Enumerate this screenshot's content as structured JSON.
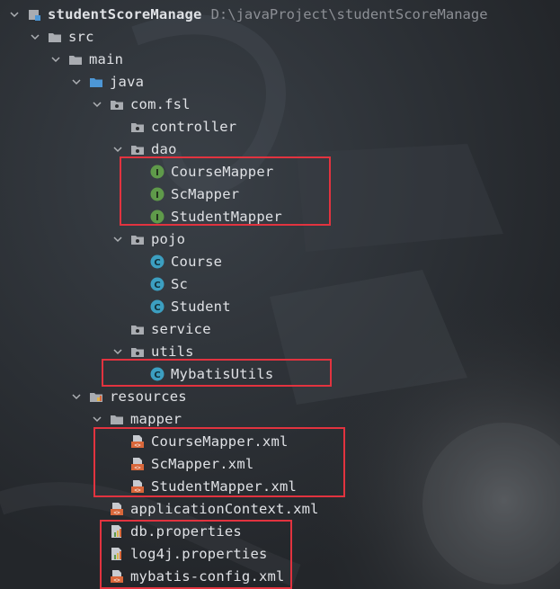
{
  "project": {
    "name": "studentScoreManage",
    "path": "D:\\javaProject\\studentScoreManage"
  },
  "tree": {
    "src": "src",
    "main": "main",
    "java": "java",
    "package": "com.fsl",
    "controller": "controller",
    "dao": "dao",
    "dao_items": [
      "CourseMapper",
      "ScMapper",
      "StudentMapper"
    ],
    "pojo": "pojo",
    "pojo_items": [
      "Course",
      "Sc",
      "Student"
    ],
    "service": "service",
    "utils": "utils",
    "utils_items": [
      "MybatisUtils"
    ],
    "resources": "resources",
    "mapper": "mapper",
    "mapper_items": [
      "CourseMapper.xml",
      "ScMapper.xml",
      "StudentMapper.xml"
    ],
    "resource_files": [
      "applicationContext.xml",
      "db.properties",
      "log4j.properties",
      "mybatis-config.xml"
    ]
  },
  "icons": {
    "interface": "interface-icon",
    "class": "class-icon",
    "folder": "folder-icon",
    "package": "package-folder-icon",
    "source_root": "source-root-icon",
    "resources_root": "resources-root-icon",
    "xml": "xml-file-icon",
    "properties": "properties-file-icon",
    "module": "module-icon"
  },
  "colors": {
    "highlight": "#e2333f",
    "interface_green": "#5f9a4a",
    "class_blue": "#3c9fc1",
    "folder_gray": "#a9acb1",
    "source_blue": "#4d97d6",
    "xml_orange": "#d9673a"
  }
}
